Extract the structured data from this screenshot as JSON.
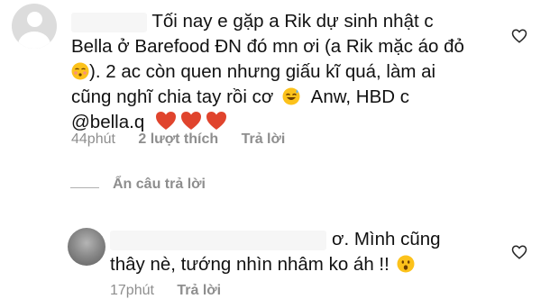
{
  "comments": [
    {
      "lines": [
        "Tối nay e gặp a Rik dự sinh nhật c",
        "Bella ở Barefood ĐN đó mn ơi (a Rik mặc áo đỏ",
        "). 2 ac còn quen nhưng giấu kĩ quá, làm ai",
        "cũng nghĩ chia tay rồi cơ",
        "Anw, HBD c",
        "@bella.q"
      ],
      "time": "44phút",
      "likes": "2 lượt thích",
      "reply_label": "Trả lời"
    },
    {
      "lines": [
        "ơ. Mình cũng",
        "thây nè, tướng nhìn nhâm ko áh !!"
      ],
      "time": "17phút",
      "reply_label": "Trả lời"
    }
  ],
  "hide_replies_label": "Ẩn câu trả lời",
  "icons": {
    "like": "heart-outline-icon",
    "emoji_kiss": "kissing-face-emoji",
    "emoji_sweat": "grinning-sweat-emoji",
    "emoji_surprise": "surprised-face-emoji",
    "emoji_heart": "red-heart-emoji"
  },
  "colors": {
    "text": "#111111",
    "meta": "#8e8e8e",
    "heart": "#e0442d",
    "emoji": "#fcc21b"
  }
}
